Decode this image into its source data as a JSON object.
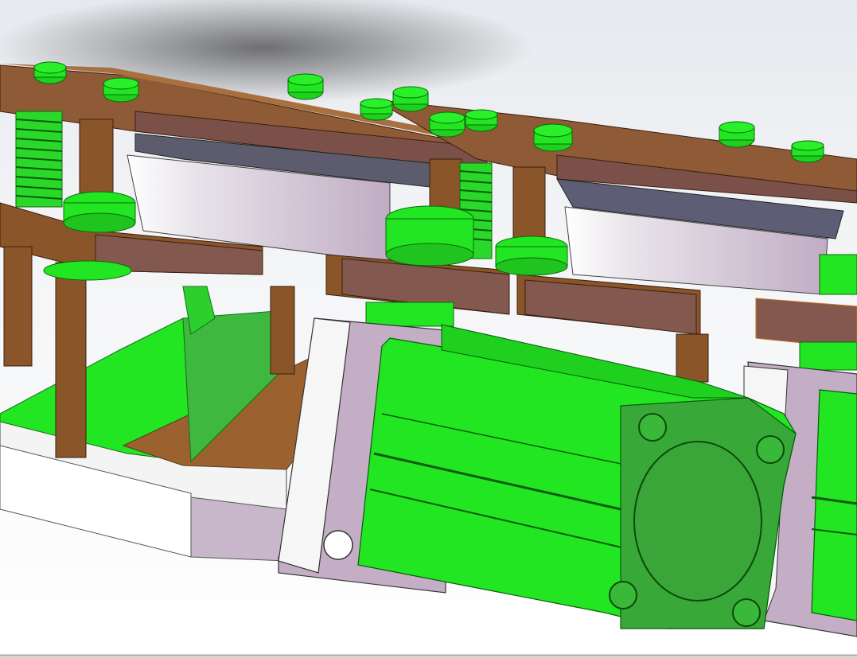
{
  "viewport": {
    "kind": "cad-3d-model-view",
    "background": "#f4f5f7",
    "colors": {
      "plate": "#8f5a36",
      "plate_edge": "#7a5550",
      "standoff": "#8a5528",
      "cylinder": "#22e622",
      "cylinder_dark": "#38a838",
      "screw": "#1fd01f",
      "block_light": "#c3aec6",
      "block_white": "#f2f2f2",
      "base": "#eeeeee",
      "wedge": "#9b6230",
      "slate": "#5c5c6e"
    },
    "icons": [
      "screw-head",
      "pneumatic-cylinder",
      "standoff-post",
      "mount-plate",
      "mount-block"
    ]
  }
}
